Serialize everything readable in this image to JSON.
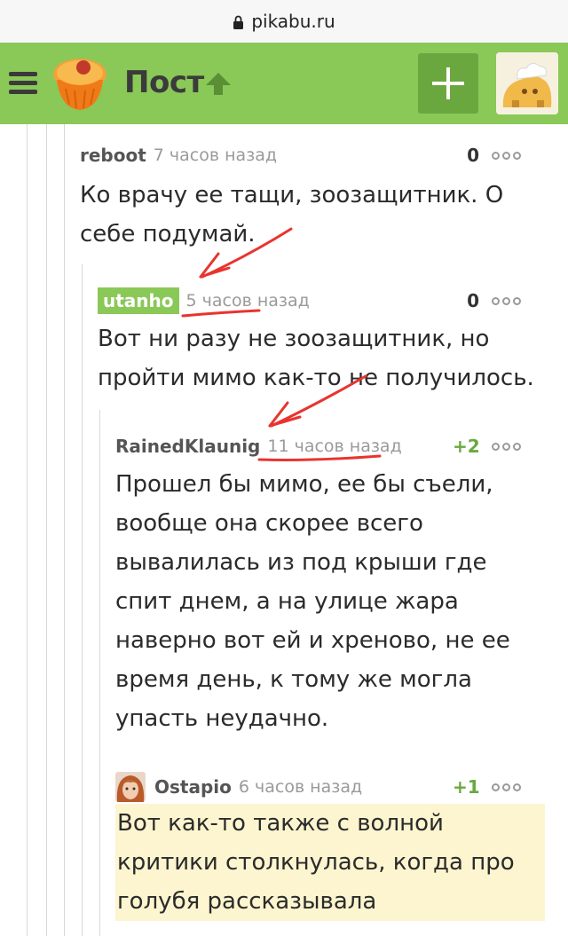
{
  "browser": {
    "url": "pikabu.ru"
  },
  "header": {
    "title": "Пост",
    "colors": {
      "green": "#8ac858",
      "button": "#6aa83f"
    },
    "icons": [
      "menu-icon",
      "pikabu-logo",
      "arrow-up-icon",
      "plus-icon",
      "user-avatar"
    ]
  },
  "comments": [
    {
      "author": "reboot",
      "time": "7 часов назад",
      "rating": "0",
      "lines": [
        "Ко врачу ее тащи, зоозащитник. О",
        "себе подумай."
      ]
    },
    {
      "author": "utanho",
      "time": "5 часов назад",
      "rating": "0",
      "highlighted_author": true,
      "lines": [
        "Вот ни разу не зоозащитник, но",
        "пройти мимо как-то не получилось."
      ]
    },
    {
      "author": "RainedKlaunig",
      "time": "11 часов назад",
      "rating": "+2",
      "lines": [
        "Прошел бы мимо, ее бы съели,",
        "вообще она скорее всего",
        "вывалилась из под крыши где",
        "спит днем, а на улице жара",
        "наверно вот ей и хреново, не ее",
        "время день, к тому же могла",
        "упасть неудачно."
      ]
    },
    {
      "author": "Ostapio",
      "time": "6 часов назад",
      "rating": "+1",
      "highlighted_body": true,
      "lines": [
        "Вот как-то также с волной",
        "критики столкнулась, когда про",
        "голубя рассказывала"
      ]
    }
  ]
}
